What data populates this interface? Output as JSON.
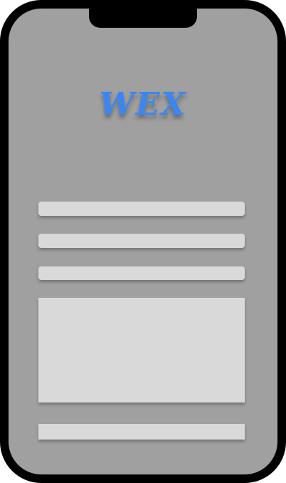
{
  "app": {
    "logo_text": "WEX"
  },
  "colors": {
    "frame": "#000000",
    "screen_background": "#a0a0a0",
    "field_background": "#d9d9d9",
    "logo_accent": "#3d86f0"
  },
  "form": {
    "field_1": {
      "value": "",
      "placeholder": ""
    },
    "field_2": {
      "value": "",
      "placeholder": ""
    },
    "field_3": {
      "value": "",
      "placeholder": ""
    },
    "message": {
      "value": "",
      "placeholder": ""
    },
    "submit_label": ""
  }
}
